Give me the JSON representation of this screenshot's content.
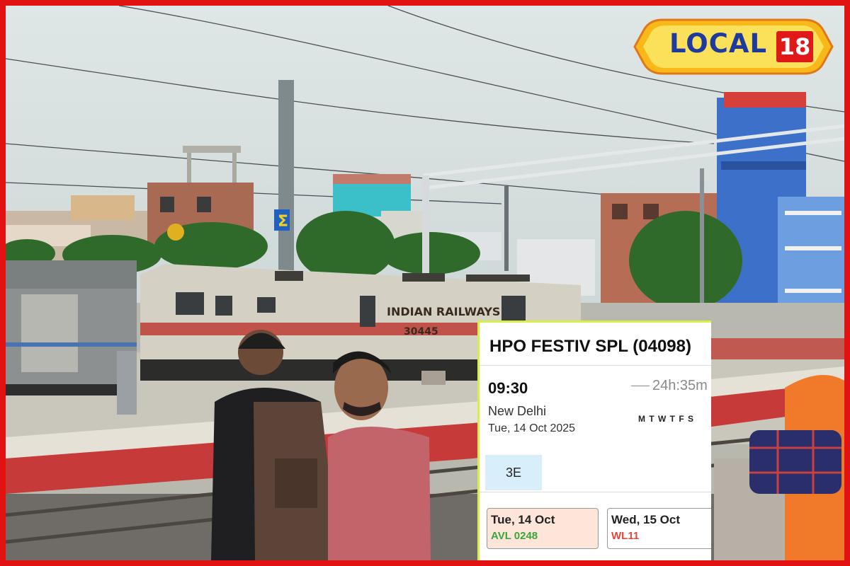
{
  "logo": {
    "text": "LOCAL",
    "number": "18"
  },
  "train_card": {
    "title": "HPO FESTIV SPL (04098)",
    "departure_time": "09:30",
    "duration": "24h:35m",
    "station": "New Delhi",
    "date": "Tue, 14 Oct  2025",
    "run_days": "M T W T F S",
    "class": "3E",
    "availability": [
      {
        "date": "Tue, 14 Oct",
        "status": "AVL 0248",
        "color": "#3aa53a"
      },
      {
        "date": "Wed, 15 Oct",
        "status": "WL11",
        "color": "#e0483a"
      }
    ]
  },
  "photo": {
    "locomotive_label": "INDIAN RAILWAYS",
    "locomotive_number": "30445"
  }
}
